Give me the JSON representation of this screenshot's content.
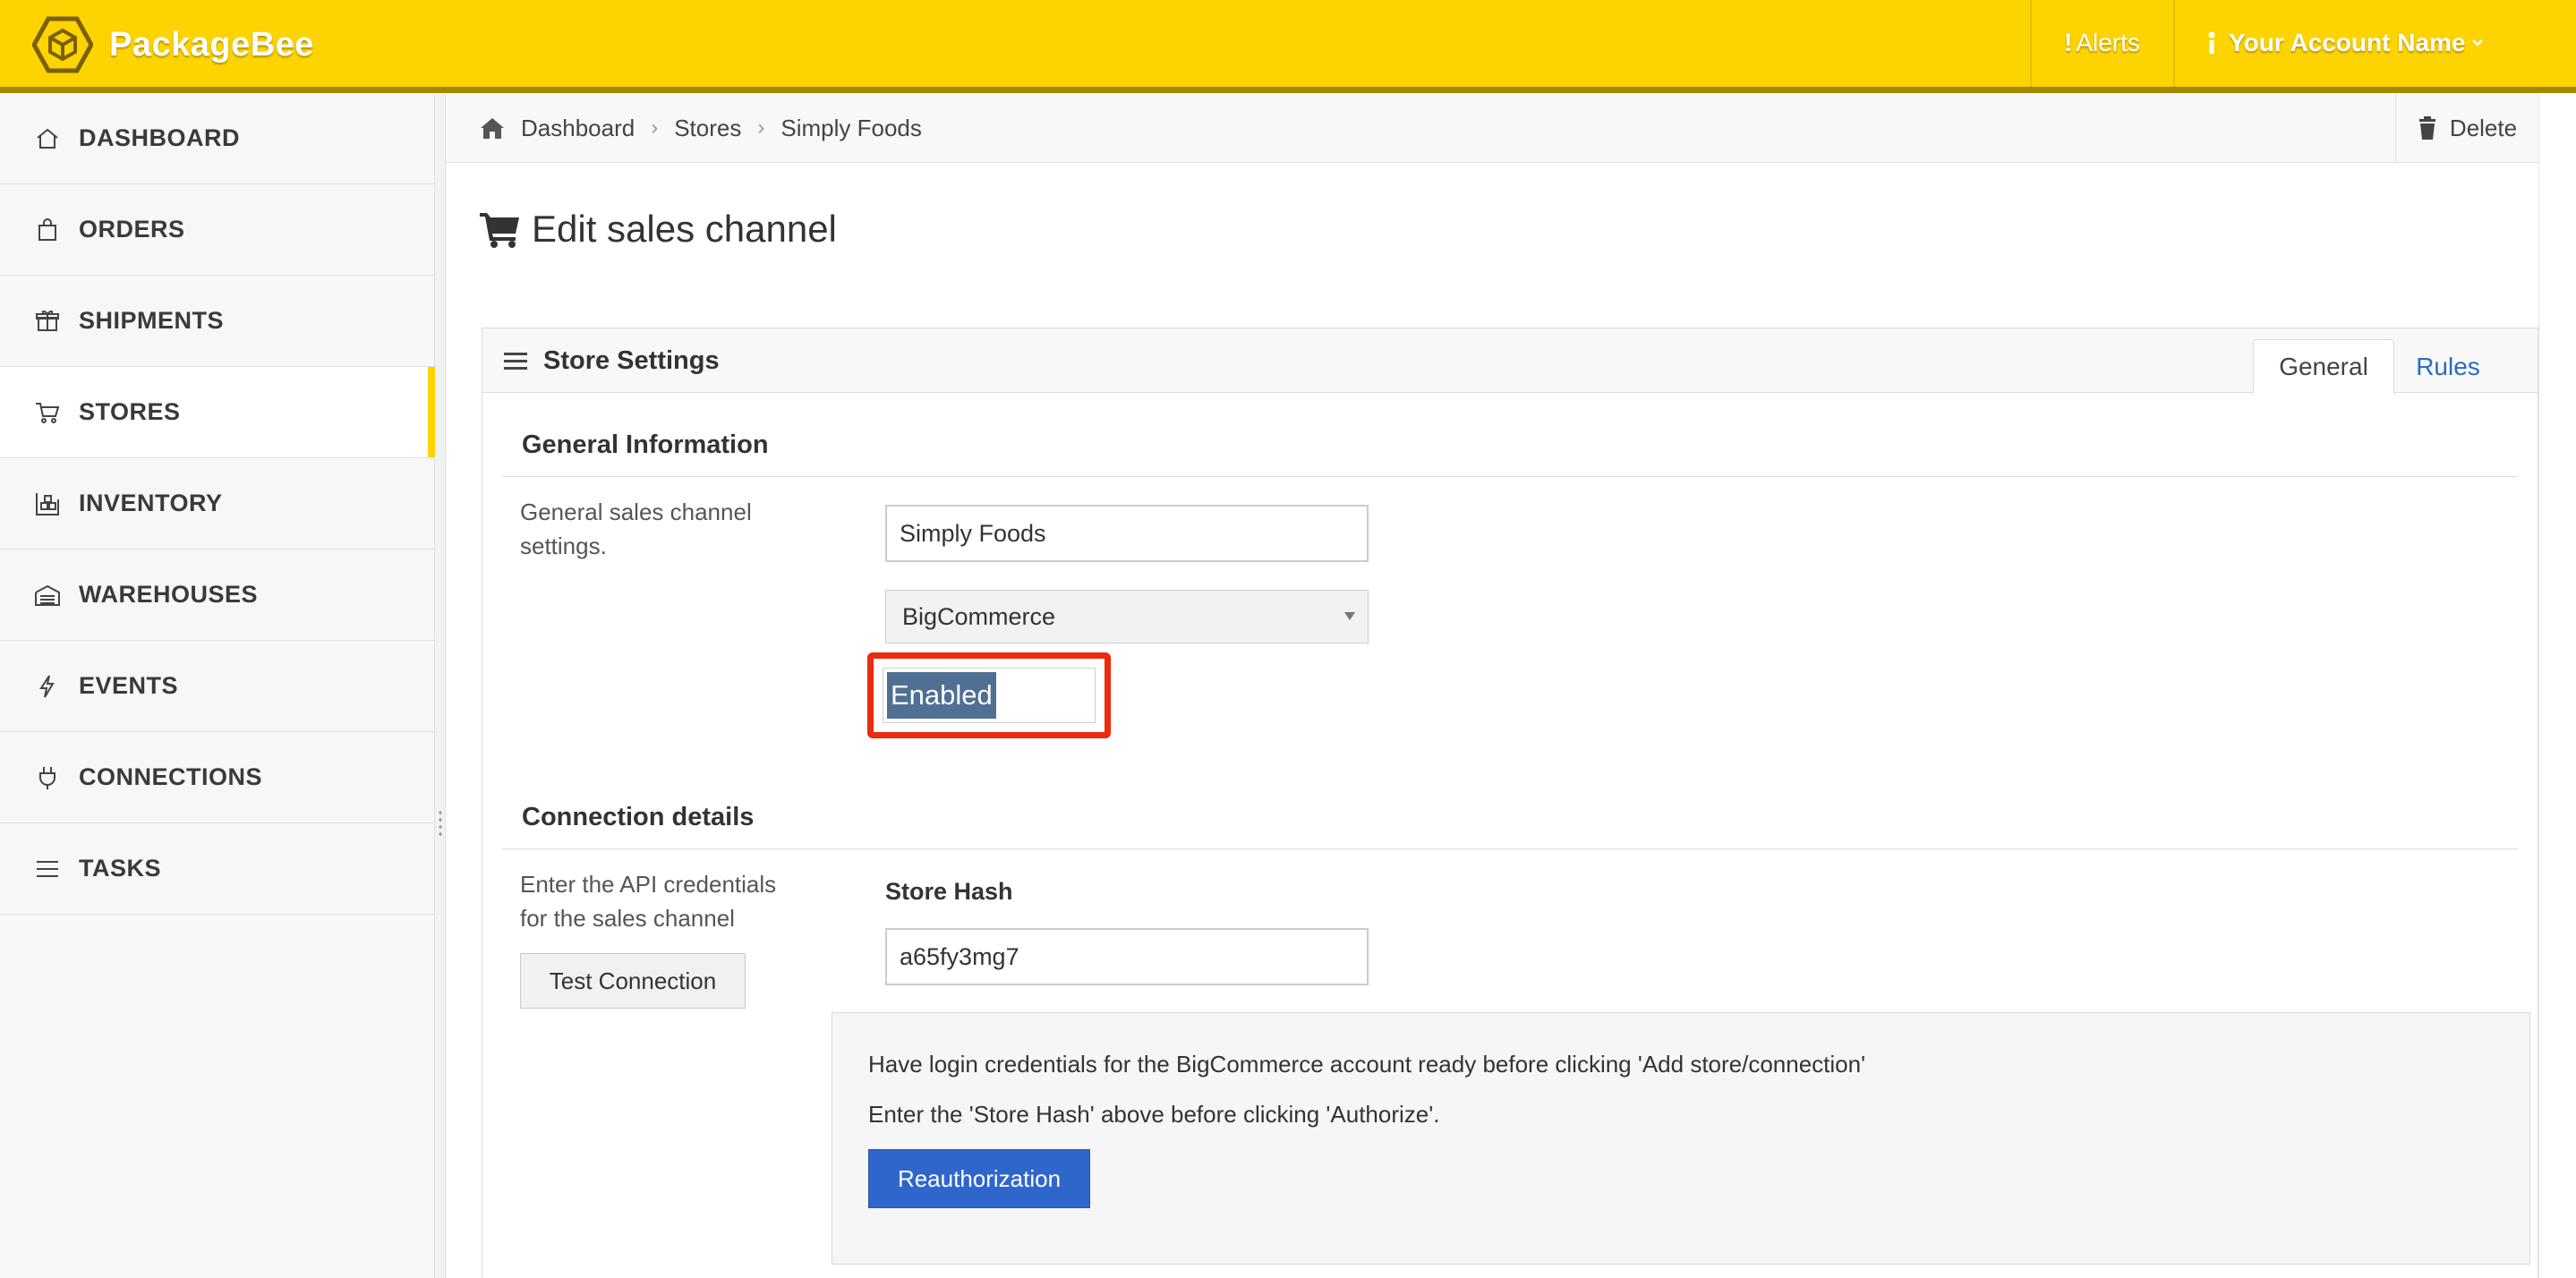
{
  "app": {
    "name": "PackageBee",
    "alerts_label": "Alerts",
    "account_label": "Your Account Name"
  },
  "sidebar": {
    "items": [
      {
        "label": "DASHBOARD",
        "icon": "home-icon"
      },
      {
        "label": "ORDERS",
        "icon": "shopping-bag-icon"
      },
      {
        "label": "SHIPMENTS",
        "icon": "package-icon"
      },
      {
        "label": "STORES",
        "icon": "cart-icon",
        "active": true
      },
      {
        "label": "INVENTORY",
        "icon": "shelves-icon"
      },
      {
        "label": "WAREHOUSES",
        "icon": "warehouse-icon"
      },
      {
        "label": "EVENTS",
        "icon": "bolt-icon"
      },
      {
        "label": "CONNECTIONS",
        "icon": "plug-icon"
      },
      {
        "label": "TASKS",
        "icon": "list-icon"
      }
    ]
  },
  "breadcrumb": {
    "items": [
      "Dashboard",
      "Stores",
      "Simply Foods"
    ],
    "delete_label": "Delete"
  },
  "page": {
    "title": "Edit sales channel"
  },
  "panel": {
    "title": "Store Settings",
    "tabs": [
      "General",
      "Rules"
    ],
    "active_tab": "General"
  },
  "general": {
    "title": "General Information",
    "description": "General sales channel settings.",
    "name_value": "Simply Foods",
    "platform_value": "BigCommerce",
    "status_value": "Enabled"
  },
  "connection": {
    "title": "Connection details",
    "description": "Enter the API credentials for the sales channel",
    "test_button": "Test Connection",
    "store_hash_label": "Store Hash",
    "store_hash_value": "a65fy3mg7",
    "info_line_1": "Have login credentials for the BigCommerce account ready before clicking 'Add store/connection'",
    "info_line_2": "Enter the 'Store Hash' above before clicking 'Authorize'.",
    "reauth_button": "Reauthorization"
  },
  "colors": {
    "topbar": "#fed400",
    "accent_blue": "#2f66cc",
    "highlight_red": "#ec2a0e",
    "selection_blue": "#4f6f93"
  }
}
